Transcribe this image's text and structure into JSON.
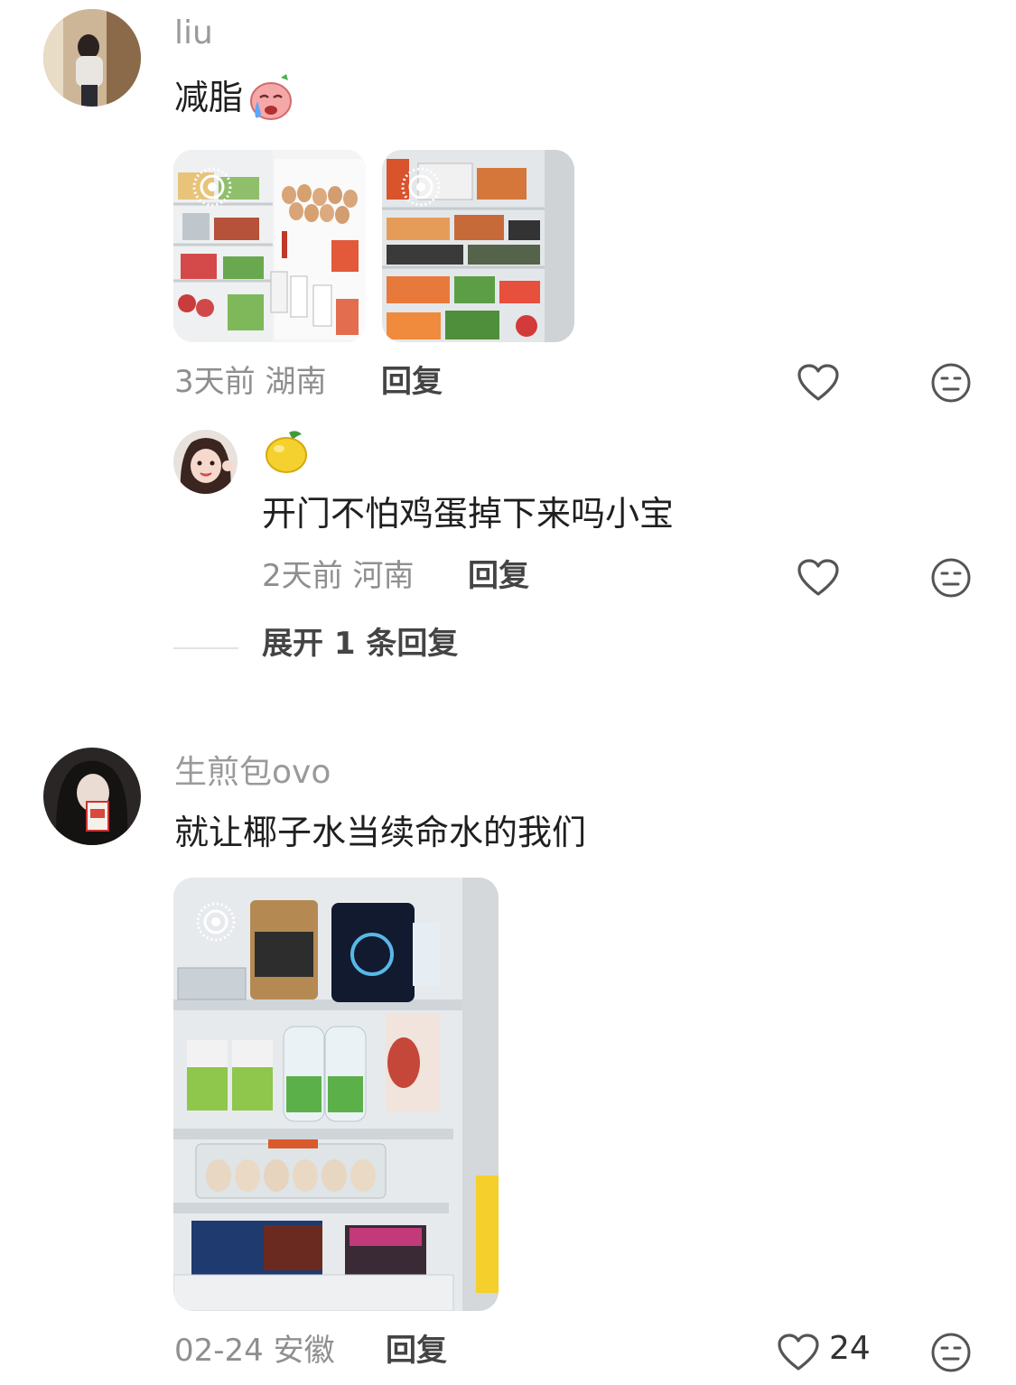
{
  "comments": [
    {
      "username": "liu",
      "text": "减脂",
      "emoji": "crying-emoji",
      "meta": "3天前 湖南",
      "reply_label": "回复",
      "replies": [
        {
          "emoji": "lemon-emoji",
          "text": "开门不怕鸡蛋掉下来吗小宝",
          "meta": "2天前 河南",
          "reply_label": "回复"
        }
      ],
      "expand_label": "展开 1 条回复"
    },
    {
      "username": "生煎包ovo",
      "text": "就让椰子水当续命水的我们",
      "meta": "02-24 安徽",
      "reply_label": "回复",
      "like_count": "24"
    }
  ],
  "colors": {
    "meta_text": "#8f8f8f",
    "username": "#9a9a9a",
    "icon_stroke": "#555555"
  }
}
